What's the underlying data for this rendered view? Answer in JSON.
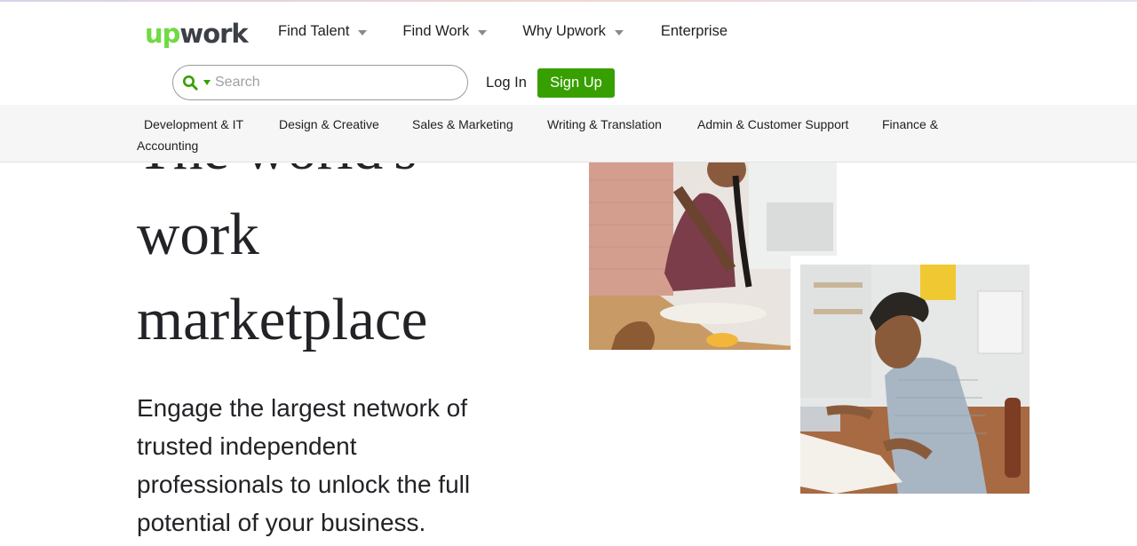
{
  "brand": {
    "logo_up": "up",
    "logo_work": "work",
    "accent": "#37a000",
    "logo_green": "#6fda44"
  },
  "nav": {
    "items": [
      {
        "label": "Find Talent",
        "has_dropdown": true
      },
      {
        "label": "Find Work",
        "has_dropdown": true
      },
      {
        "label": "Why Upwork",
        "has_dropdown": true
      },
      {
        "label": "Enterprise",
        "has_dropdown": false
      }
    ]
  },
  "search": {
    "placeholder": "Search",
    "value": ""
  },
  "auth": {
    "login_label": "Log In",
    "signup_label": "Sign Up"
  },
  "categories": [
    "Development & IT",
    "Design & Creative",
    "Sales & Marketing",
    "Writing & Translation",
    "Admin & Customer Support",
    "Finance &",
    "Accounting"
  ],
  "hero": {
    "title_line1": "The world's",
    "title_line2": "work",
    "title_line3": "marketplace",
    "subtitle": "Engage the largest network of trusted independent professionals to unlock the full potential of your business."
  }
}
